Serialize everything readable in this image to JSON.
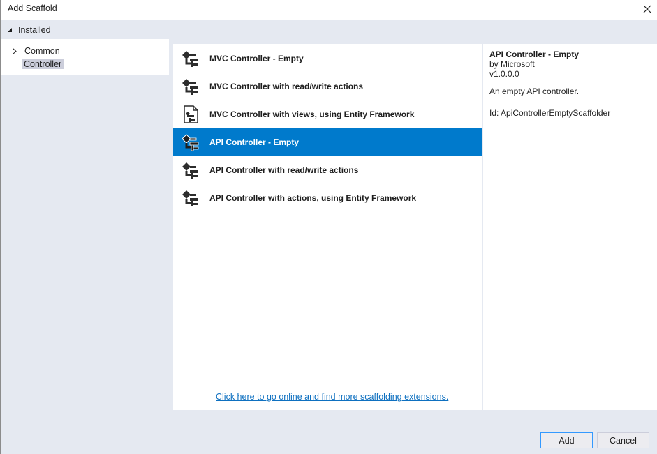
{
  "window": {
    "title": "Add Scaffold",
    "close_icon": "close-icon"
  },
  "installed": {
    "label": "Installed"
  },
  "tree": {
    "items": [
      {
        "label": "Common",
        "expandable": true
      },
      {
        "label": "Controller",
        "selected": true
      }
    ]
  },
  "scaffolders": [
    {
      "name": "MVC Controller - Empty",
      "icon": "controller-icon"
    },
    {
      "name": "MVC Controller with read/write actions",
      "icon": "controller-icon"
    },
    {
      "name": "MVC Controller with views, using Entity Framework",
      "icon": "views-controller-icon"
    },
    {
      "name": "API Controller - Empty",
      "icon": "controller-icon",
      "selected": true
    },
    {
      "name": "API Controller with read/write actions",
      "icon": "controller-icon"
    },
    {
      "name": "API Controller with actions, using Entity Framework",
      "icon": "controller-icon"
    }
  ],
  "online_link": "Click here to go online and find more scaffolding extensions.",
  "details": {
    "title": "API Controller - Empty",
    "author": "by Microsoft",
    "version": "v1.0.0.0",
    "description": "An empty API controller.",
    "id": "Id: ApiControllerEmptyScaffolder"
  },
  "buttons": {
    "add": "Add",
    "cancel": "Cancel"
  },
  "colors": {
    "selection": "#007acc",
    "link": "#0e70c0",
    "dialog_bg": "#e5e9f1"
  }
}
